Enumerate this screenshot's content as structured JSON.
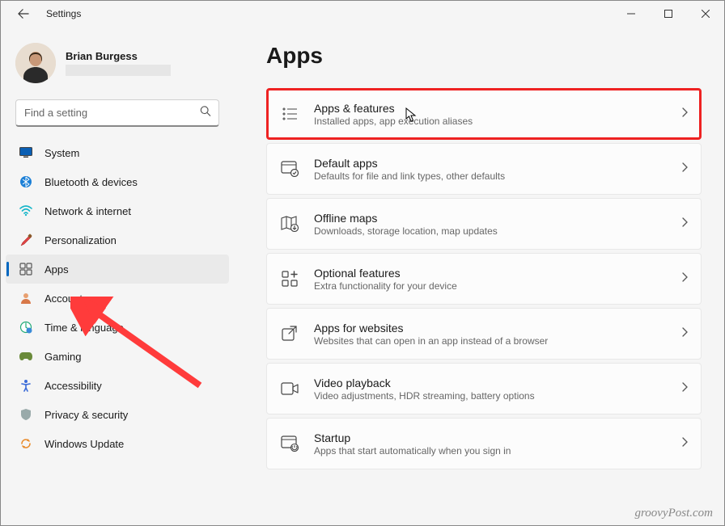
{
  "window": {
    "title": "Settings"
  },
  "profile": {
    "name": "Brian Burgess"
  },
  "search": {
    "placeholder": "Find a setting"
  },
  "sidebar": {
    "items": [
      {
        "label": "System"
      },
      {
        "label": "Bluetooth & devices"
      },
      {
        "label": "Network & internet"
      },
      {
        "label": "Personalization"
      },
      {
        "label": "Apps"
      },
      {
        "label": "Accounts"
      },
      {
        "label": "Time & language"
      },
      {
        "label": "Gaming"
      },
      {
        "label": "Accessibility"
      },
      {
        "label": "Privacy & security"
      },
      {
        "label": "Windows Update"
      }
    ]
  },
  "page": {
    "title": "Apps"
  },
  "cards": [
    {
      "title": "Apps & features",
      "desc": "Installed apps, app execution aliases"
    },
    {
      "title": "Default apps",
      "desc": "Defaults for file and link types, other defaults"
    },
    {
      "title": "Offline maps",
      "desc": "Downloads, storage location, map updates"
    },
    {
      "title": "Optional features",
      "desc": "Extra functionality for your device"
    },
    {
      "title": "Apps for websites",
      "desc": "Websites that can open in an app instead of a browser"
    },
    {
      "title": "Video playback",
      "desc": "Video adjustments, HDR streaming, battery options"
    },
    {
      "title": "Startup",
      "desc": "Apps that start automatically when you sign in"
    }
  ],
  "watermark": "groovyPost.com"
}
